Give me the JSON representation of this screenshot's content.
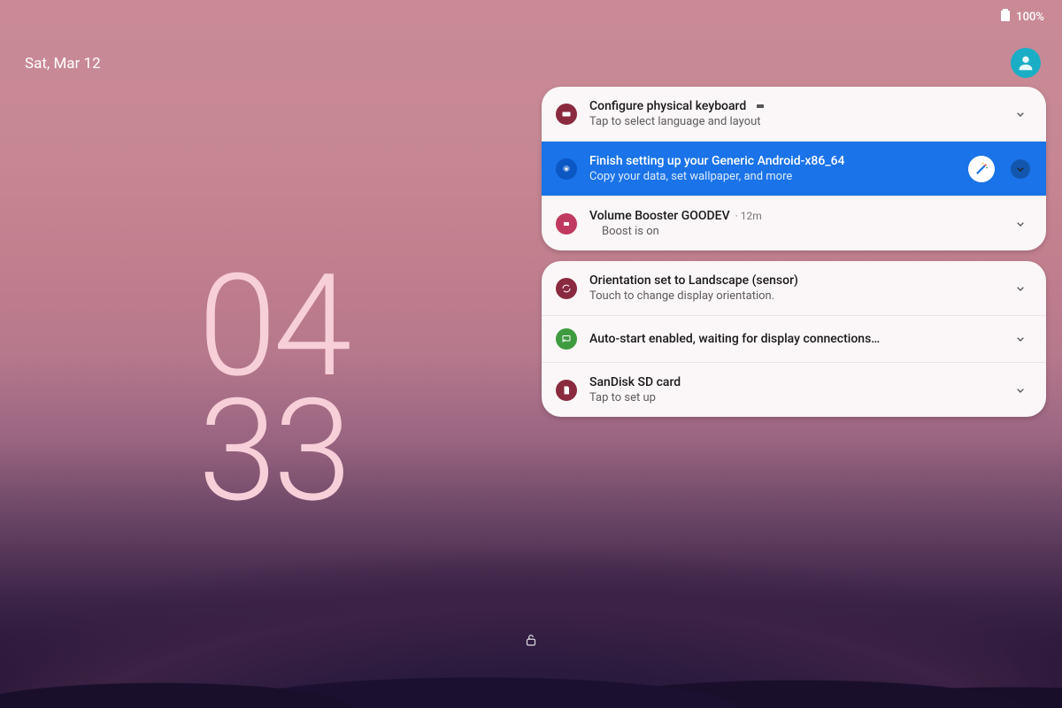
{
  "status": {
    "battery_text": "100%"
  },
  "date": "Sat, Mar 12",
  "clock": {
    "hours": "04",
    "minutes": "33"
  },
  "groups": [
    {
      "items": [
        {
          "icon_name": "keyboard-icon",
          "icon_bg": "#8a2a3f",
          "title": "Configure physical keyboard",
          "sub": "Tap to select language and layout",
          "highlight": false,
          "show_keyboard_chip": true,
          "expandable": true
        },
        {
          "icon_name": "gear-icon",
          "icon_bg": "#0b57c4",
          "title": "Finish setting up your Generic Android-x86_64",
          "sub": "Copy your data, set wallpaper, and more",
          "highlight": true,
          "show_wand": true,
          "expandable": true
        },
        {
          "icon_name": "booster-icon",
          "icon_bg": "#c03a5f",
          "title": "Volume Booster GOODEV",
          "meta": "· 12m",
          "sub": "Boost is on",
          "sub_indent": true,
          "highlight": false,
          "expandable": true
        }
      ]
    },
    {
      "items": [
        {
          "icon_name": "orientation-icon",
          "icon_bg": "#8a2a3f",
          "title": "Orientation set to Landscape (sensor)",
          "sub": "Touch to change display orientation.",
          "highlight": false,
          "expandable": true
        },
        {
          "icon_name": "cast-icon",
          "icon_bg": "#3f9b3f",
          "title": "Auto-start enabled, waiting for display connections…",
          "highlight": false,
          "expandable": true
        },
        {
          "icon_name": "sdcard-icon",
          "icon_bg": "#8a2a3f",
          "title": "SanDisk SD card",
          "sub": "Tap to set up",
          "highlight": false,
          "expandable": true
        }
      ]
    }
  ]
}
